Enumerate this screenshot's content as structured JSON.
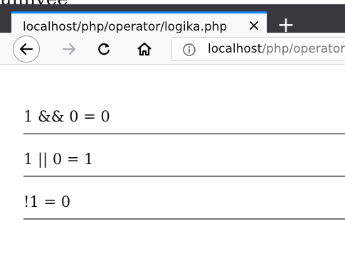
{
  "top_clip_text": "ullnyee",
  "tab": {
    "title": "localhost/php/operator/logika.php",
    "close_glyph": "×"
  },
  "new_tab_glyph": "+",
  "url": {
    "host": "localhost",
    "path": "/php/operator/logika.php"
  },
  "results": [
    {
      "text": "1 && 0 = 0"
    },
    {
      "text": "1 || 0 = 1"
    },
    {
      "text": "!1 = 0"
    }
  ],
  "icons": {
    "back": "arrow-left-icon",
    "forward": "arrow-right-icon",
    "reload": "reload-icon",
    "home": "home-icon",
    "info": "info-icon"
  }
}
